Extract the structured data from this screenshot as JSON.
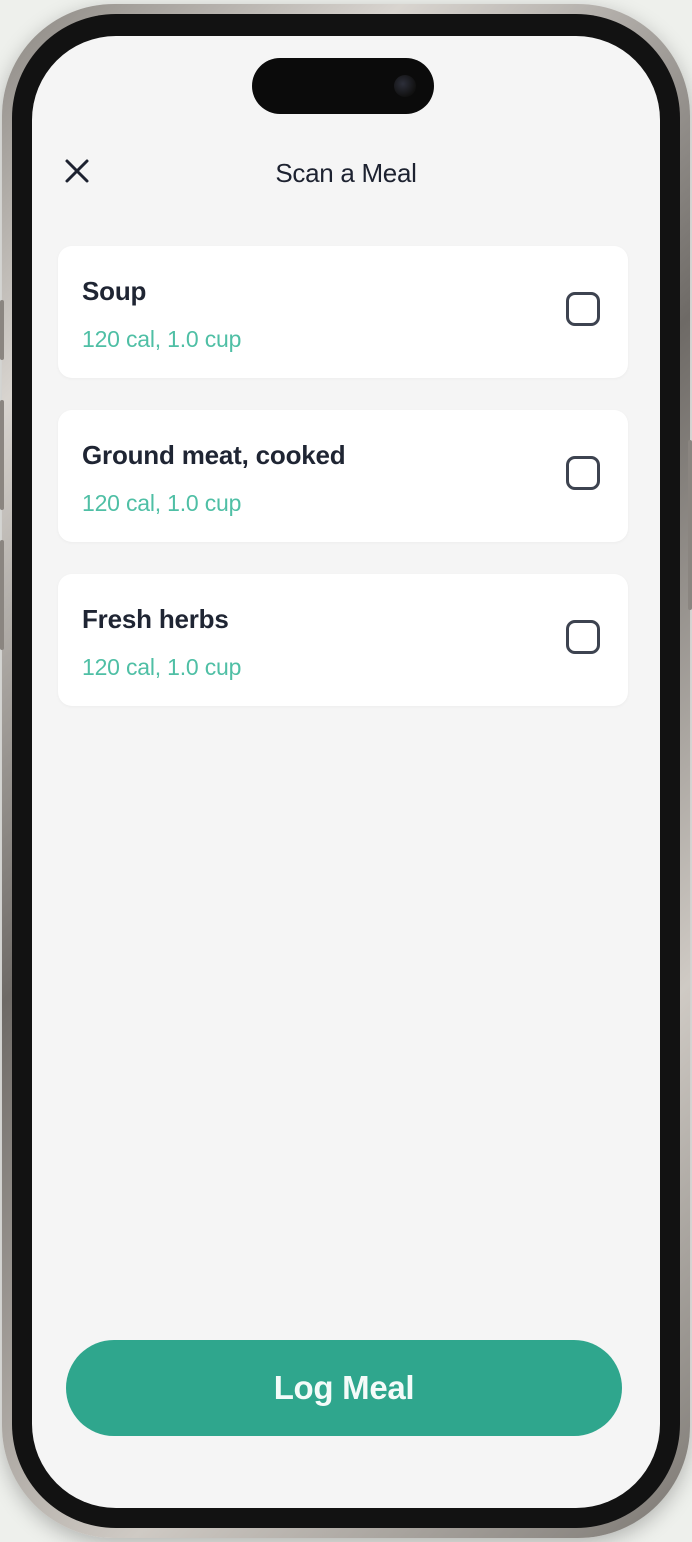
{
  "header": {
    "title": "Scan a Meal",
    "close_icon": "close-icon"
  },
  "items": [
    {
      "name": "Soup",
      "detail": "120 cal, 1.0 cup",
      "checked": false
    },
    {
      "name": "Ground meat, cooked",
      "detail": "120 cal, 1.0 cup",
      "checked": false
    },
    {
      "name": "Fresh herbs",
      "detail": "120 cal, 1.0 cup",
      "checked": false
    }
  ],
  "footer": {
    "log_button_label": "Log Meal"
  },
  "colors": {
    "accent": "#2fa68d",
    "detail_text": "#4fbfa5",
    "title_text": "#1d2230",
    "screen_background": "#f5f5f5",
    "card_background": "#ffffff"
  }
}
